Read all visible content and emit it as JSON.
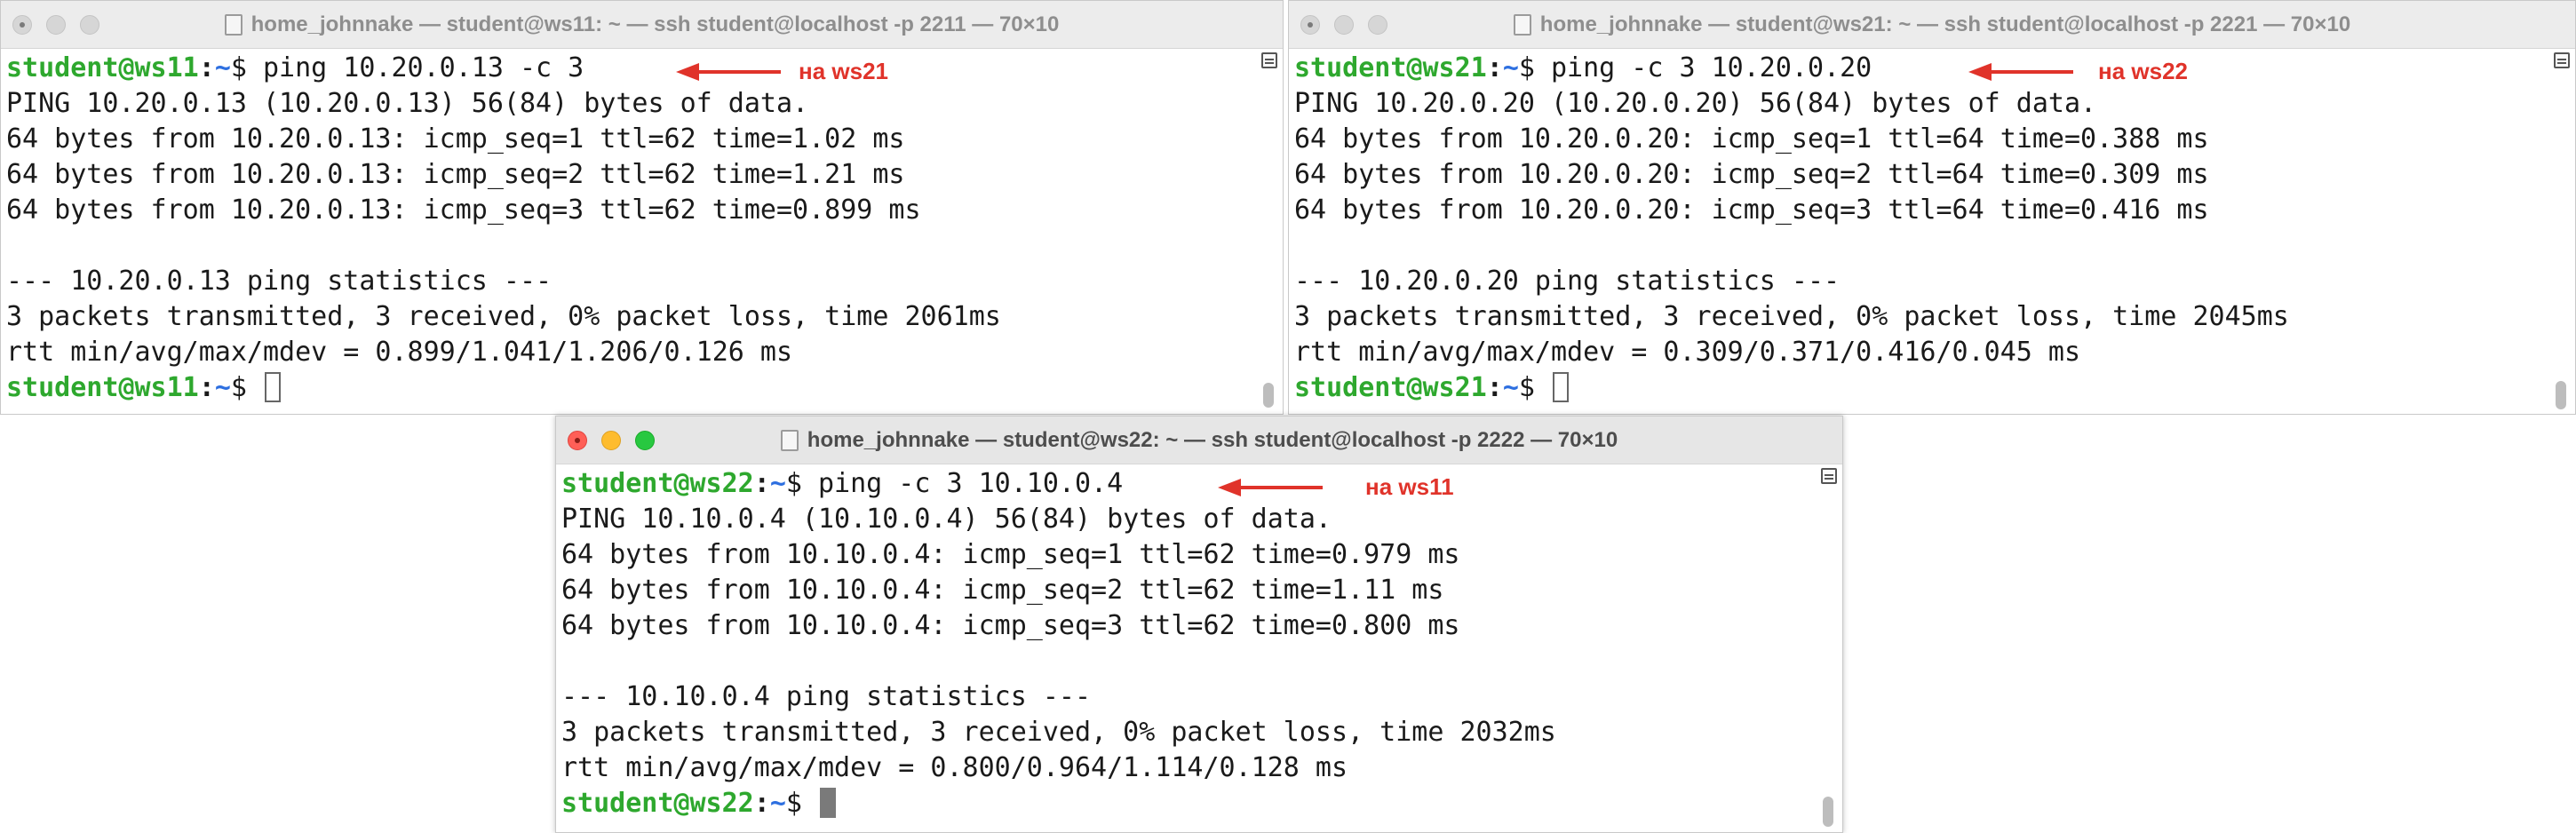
{
  "windows": [
    {
      "id": "ws11",
      "title": "home_johnnake — student@ws11: ~ — ssh student@localhost -p 2211 — 70×10",
      "prompt_user": "student@ws11",
      "prompt_path": "~",
      "prompt_symbol": "$ ",
      "command": "ping 10.20.0.13 -c 3",
      "annotation": "на ws21",
      "output": [
        "PING 10.20.0.13 (10.20.0.13) 56(84) bytes of data.",
        "64 bytes from 10.20.0.13: icmp_seq=1 ttl=62 time=1.02 ms",
        "64 bytes from 10.20.0.13: icmp_seq=2 ttl=62 time=1.21 ms",
        "64 bytes from 10.20.0.13: icmp_seq=3 ttl=62 time=0.899 ms",
        "",
        "--- 10.20.0.13 ping statistics ---",
        "3 packets transmitted, 3 received, 0% packet loss, time 2061ms",
        "rtt min/avg/max/mdev = 0.899/1.041/1.206/0.126 ms"
      ]
    },
    {
      "id": "ws21",
      "title": "home_johnnake — student@ws21: ~ — ssh student@localhost -p 2221 — 70×10",
      "prompt_user": "student@ws21",
      "prompt_path": "~",
      "prompt_symbol": "$ ",
      "command": "ping -c 3 10.20.0.20",
      "annotation": "на ws22",
      "output": [
        "PING 10.20.0.20 (10.20.0.20) 56(84) bytes of data.",
        "64 bytes from 10.20.0.20: icmp_seq=1 ttl=64 time=0.388 ms",
        "64 bytes from 10.20.0.20: icmp_seq=2 ttl=64 time=0.309 ms",
        "64 bytes from 10.20.0.20: icmp_seq=3 ttl=64 time=0.416 ms",
        "",
        "--- 10.20.0.20 ping statistics ---",
        "3 packets transmitted, 3 received, 0% packet loss, time 2045ms",
        "rtt min/avg/max/mdev = 0.309/0.371/0.416/0.045 ms"
      ]
    },
    {
      "id": "ws22",
      "title": "home_johnnake — student@ws22: ~ — ssh student@localhost -p 2222 — 70×10",
      "prompt_user": "student@ws22",
      "prompt_path": "~",
      "prompt_symbol": "$ ",
      "command": "ping -c 3 10.10.0.4",
      "annotation": "на ws11",
      "output": [
        "PING 10.10.0.4 (10.10.0.4) 56(84) bytes of data.",
        "64 bytes from 10.10.0.4: icmp_seq=1 ttl=62 time=0.979 ms",
        "64 bytes from 10.10.0.4: icmp_seq=2 ttl=62 time=1.11 ms",
        "64 bytes from 10.10.0.4: icmp_seq=3 ttl=62 time=0.800 ms",
        "",
        "--- 10.10.0.4 ping statistics ---",
        "3 packets transmitted, 3 received, 0% packet loss, time 2032ms",
        "rtt min/avg/max/mdev = 0.800/0.964/1.114/0.128 ms"
      ]
    }
  ],
  "colors": {
    "prompt_user": "#2ea82e",
    "prompt_path": "#2d6fe0",
    "annotation": "#e0332a",
    "traffic_red": "#ff5f57",
    "traffic_yellow": "#febc2e",
    "traffic_green": "#28c840"
  }
}
